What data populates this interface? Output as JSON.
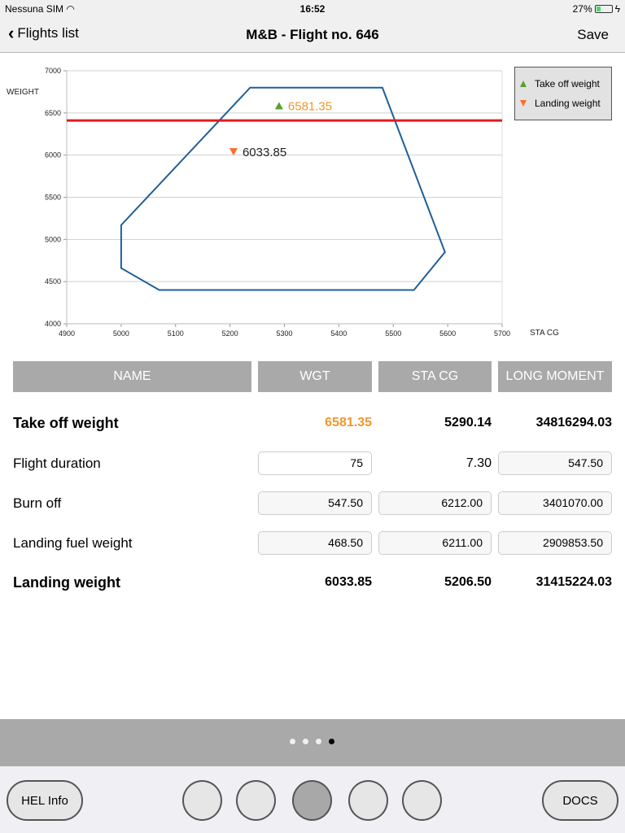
{
  "status_bar": {
    "carrier": "Nessuna SIM",
    "wifi_icon": "wifi-icon",
    "time": "16:52",
    "battery_percent": "27%",
    "battery_level": 0.27,
    "charging_icon": "bolt-icon"
  },
  "nav": {
    "back_label": "Flights list",
    "title": "M&B - Flight no. 646",
    "save_label": "Save"
  },
  "legend": {
    "items": [
      {
        "label": "Take off weight",
        "color": "#5aa02c",
        "marker": "triangle-up"
      },
      {
        "label": "Landing weight",
        "color": "#ff6a2b",
        "marker": "triangle-down"
      }
    ]
  },
  "chart_data": {
    "type": "scatter",
    "xlabel": "STA CG",
    "ylabel": "WEIGHT",
    "xlim": [
      4900,
      5700
    ],
    "ylim": [
      4000,
      7000
    ],
    "x_ticks": [
      4900,
      5000,
      5100,
      5200,
      5300,
      5400,
      5500,
      5600,
      5700
    ],
    "y_ticks": [
      4000,
      4500,
      5000,
      5500,
      6000,
      6500,
      7000
    ],
    "grid": true,
    "legend_position": "top-right",
    "envelope": {
      "name": "CG envelope",
      "color": "#1f5f99",
      "points": [
        [
          5000,
          5170
        ],
        [
          5000,
          4660
        ],
        [
          5070,
          4400
        ],
        [
          5538,
          4400
        ],
        [
          5595,
          4850
        ],
        [
          5480,
          6800
        ],
        [
          5237,
          6800
        ]
      ]
    },
    "limit_line": {
      "name": "Max weight",
      "color": "#e01b1b",
      "y": 6410
    },
    "series": [
      {
        "name": "Take off weight",
        "marker": "triangle-up",
        "color": "#5aa02c",
        "label_color": "#f0962d",
        "x": 5290.14,
        "y": 6581.35,
        "label": "6581.35"
      },
      {
        "name": "Landing weight",
        "marker": "triangle-down",
        "color": "#ff6a2b",
        "label_color": "#222222",
        "x": 5206.5,
        "y": 6033.85,
        "label": "6033.85"
      }
    ]
  },
  "table": {
    "headers": [
      "NAME",
      "WGT",
      "STA CG",
      "LONG MOMENT"
    ],
    "rows": [
      {
        "name": "Take off weight",
        "wgt": "6581.35",
        "sta_cg": "5290.14",
        "long_moment": "34816294.03"
      },
      {
        "name": "Flight duration",
        "wgt": "75",
        "sta_cg": "7.30",
        "long_moment": "547.50"
      },
      {
        "name": "Burn off",
        "wgt": "547.50",
        "sta_cg": "6212.00",
        "long_moment": "3401070.00"
      },
      {
        "name": "Landing fuel weight",
        "wgt": "468.50",
        "sta_cg": "6211.00",
        "long_moment": "2909853.50"
      },
      {
        "name": "Landing weight",
        "wgt": "6033.85",
        "sta_cg": "5206.50",
        "long_moment": "31415224.03"
      }
    ],
    "highlight_color": "#f0962d"
  },
  "pager": {
    "count": 4,
    "active": 4
  },
  "bottom": {
    "hel_info_label": "HEL Info",
    "docs_label": "DOCS",
    "circle_count": 5,
    "active_circle": 3
  }
}
